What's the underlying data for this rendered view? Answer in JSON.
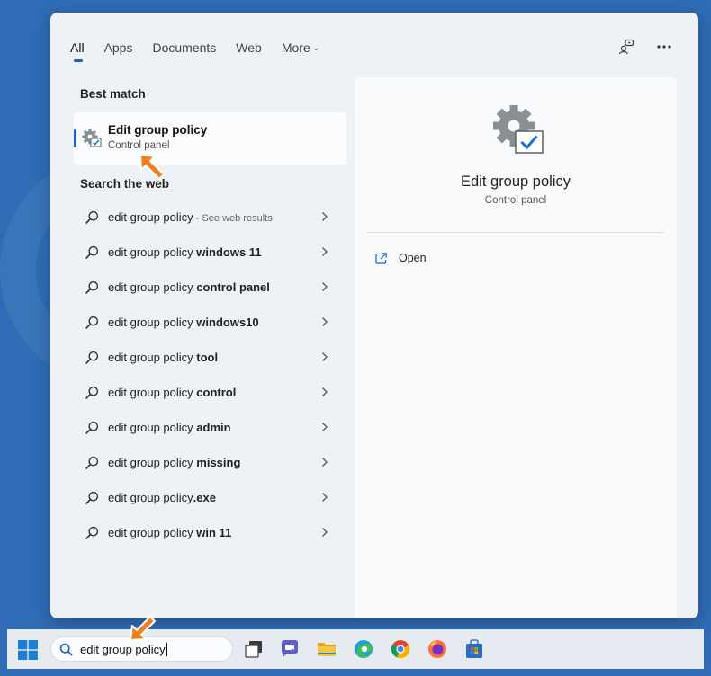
{
  "tabs": [
    {
      "label": "All",
      "active": true
    },
    {
      "label": "Apps",
      "active": false
    },
    {
      "label": "Documents",
      "active": false
    },
    {
      "label": "Web",
      "active": false
    },
    {
      "label": "More",
      "active": false
    }
  ],
  "top_icons": [
    "account-switch-icon",
    "more-options-icon"
  ],
  "best_match": {
    "section_title": "Best match",
    "title": "Edit group policy",
    "subtitle": "Control panel",
    "icon": "group-policy-gear-icon"
  },
  "search_web": {
    "section_title": "Search the web",
    "results": [
      {
        "prefix": "edit group policy",
        "bold": "",
        "hint": " - See web results"
      },
      {
        "prefix": "edit group policy ",
        "bold": "windows 11",
        "hint": ""
      },
      {
        "prefix": "edit group policy ",
        "bold": "control panel",
        "hint": ""
      },
      {
        "prefix": "edit group policy ",
        "bold": "windows10",
        "hint": ""
      },
      {
        "prefix": "edit group policy ",
        "bold": "tool",
        "hint": ""
      },
      {
        "prefix": "edit group policy ",
        "bold": "control",
        "hint": ""
      },
      {
        "prefix": "edit group policy ",
        "bold": "admin",
        "hint": ""
      },
      {
        "prefix": "edit group policy ",
        "bold": "missing",
        "hint": ""
      },
      {
        "prefix": "edit group policy",
        "bold": ".exe",
        "hint": ""
      },
      {
        "prefix": "edit group policy ",
        "bold": "win 11",
        "hint": ""
      }
    ]
  },
  "preview": {
    "title": "Edit group policy",
    "subtitle": "Control panel",
    "actions": [
      {
        "label": "Open",
        "icon": "open-external-icon"
      }
    ]
  },
  "taskbar": {
    "search_value": "edit group policy",
    "icons": [
      "windows-logo-icon",
      "task-view-icon",
      "chat-icon",
      "file-explorer-icon",
      "edge-icon",
      "chrome-icon",
      "firefox-icon",
      "microsoft-store-icon"
    ]
  },
  "colors": {
    "desktop": "#2f6cb5",
    "accent": "#1763c6",
    "arrow": "#f07d1e"
  }
}
